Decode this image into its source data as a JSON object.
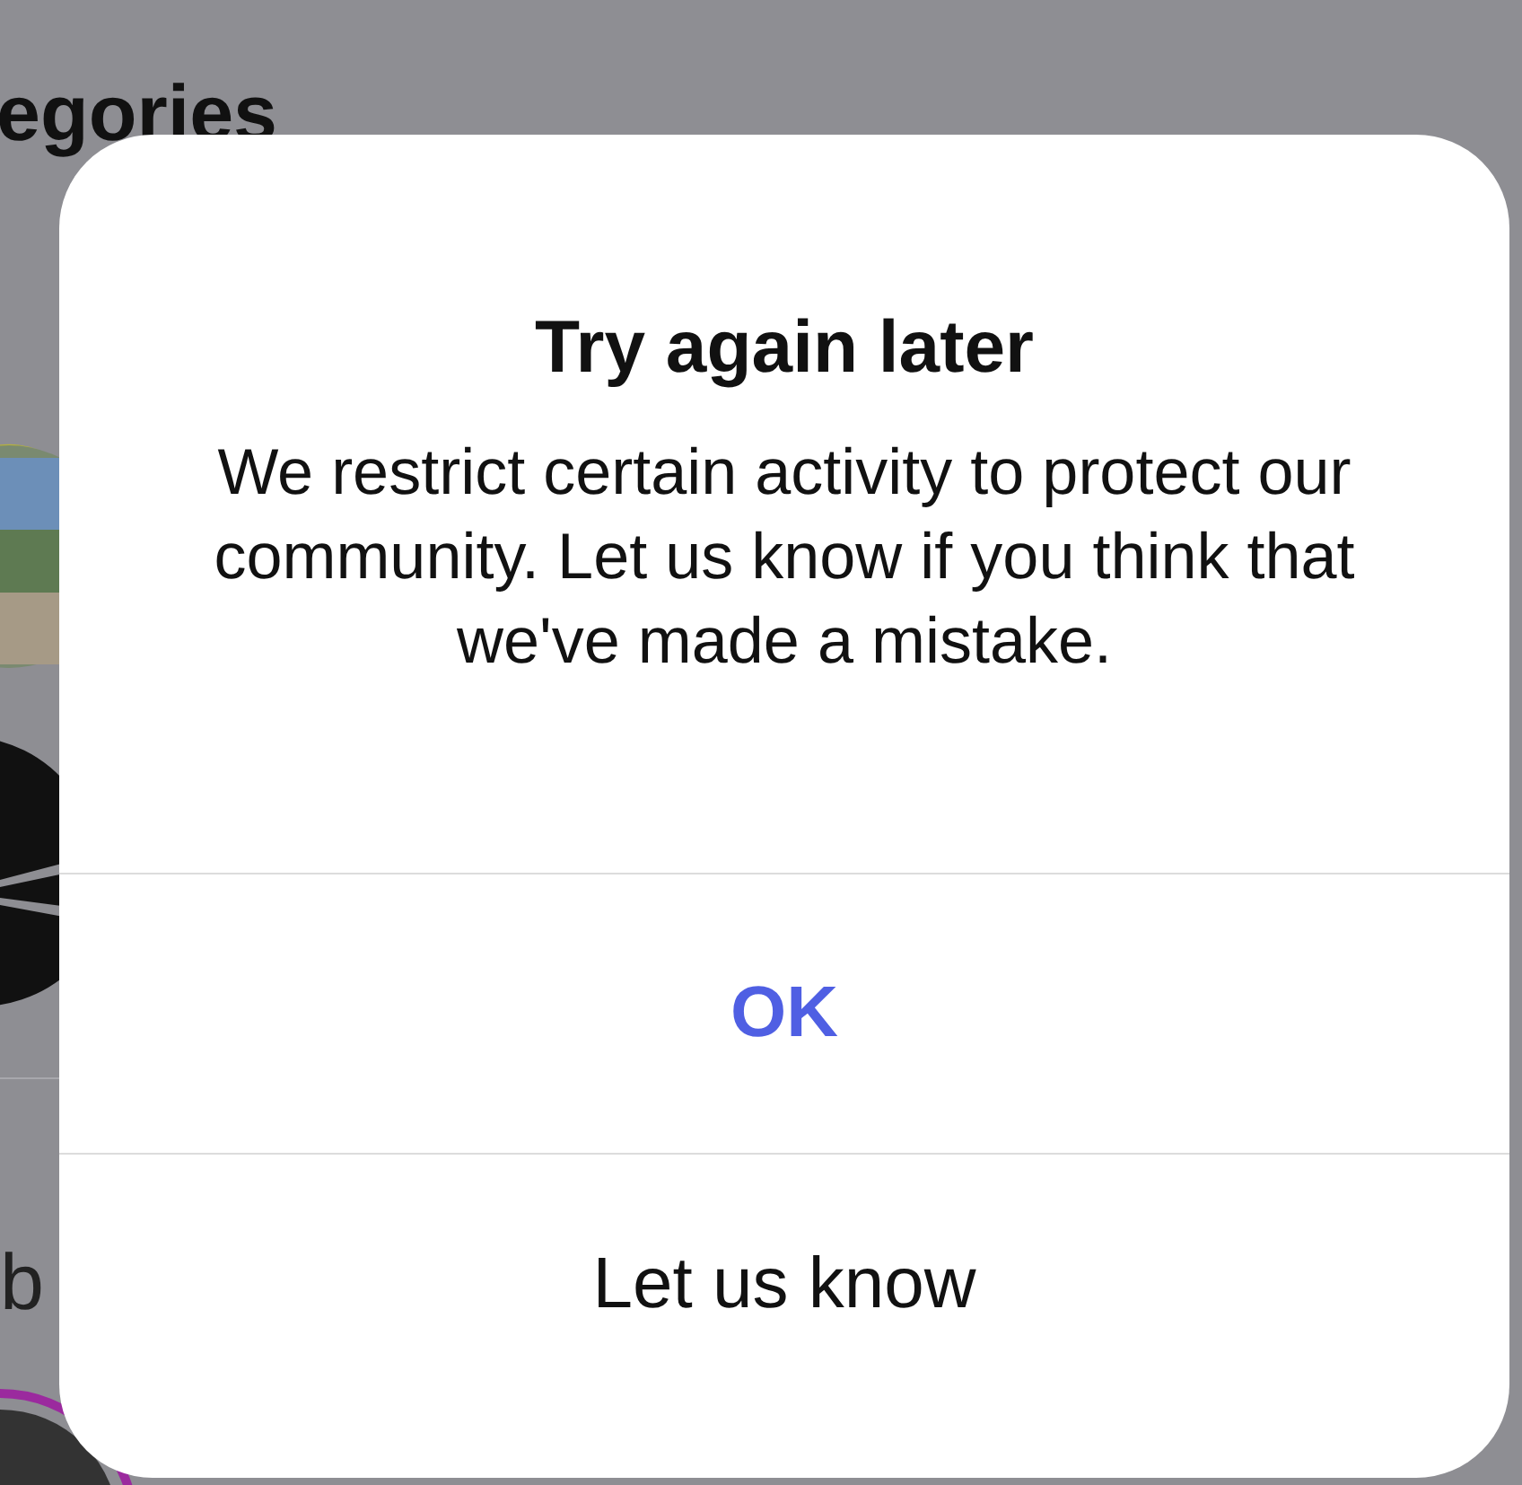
{
  "background": {
    "heading": "egories",
    "row_letter": "b"
  },
  "dialog": {
    "title": "Try again later",
    "message": "We restrict certain activity to protect our community. Let us know if you think that we've made a mistake.",
    "buttons": [
      {
        "label": "OK",
        "kind": "primary"
      },
      {
        "label": "Let us know",
        "kind": "plain"
      }
    ]
  }
}
